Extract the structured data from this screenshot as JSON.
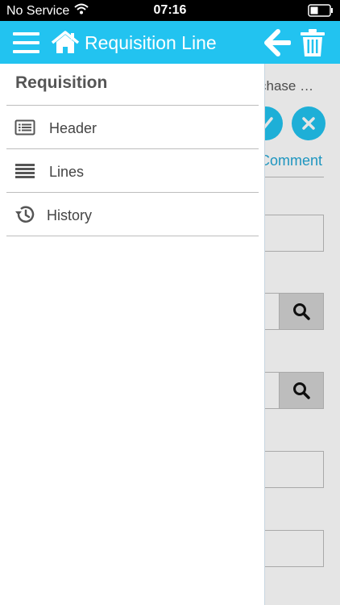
{
  "status_bar": {
    "carrier": "No Service",
    "time": "07:16",
    "wifi_icon": "wifi-icon",
    "battery_icon": "battery-icon"
  },
  "header": {
    "title": "Requisition Line",
    "menu_icon": "menu-icon",
    "home_icon": "home-icon",
    "back_icon": "back-arrow-icon",
    "delete_icon": "trash-icon",
    "color": "#22c3f0"
  },
  "drawer": {
    "title": "Requisition",
    "items": [
      {
        "label": "Header",
        "icon": "header-list-icon"
      },
      {
        "label": "Lines",
        "icon": "lines-icon"
      },
      {
        "label": "History",
        "icon": "history-icon"
      }
    ]
  },
  "background": {
    "purchase_text": "chase …",
    "comment_link": "Comment",
    "accent": "#22c3f0"
  }
}
